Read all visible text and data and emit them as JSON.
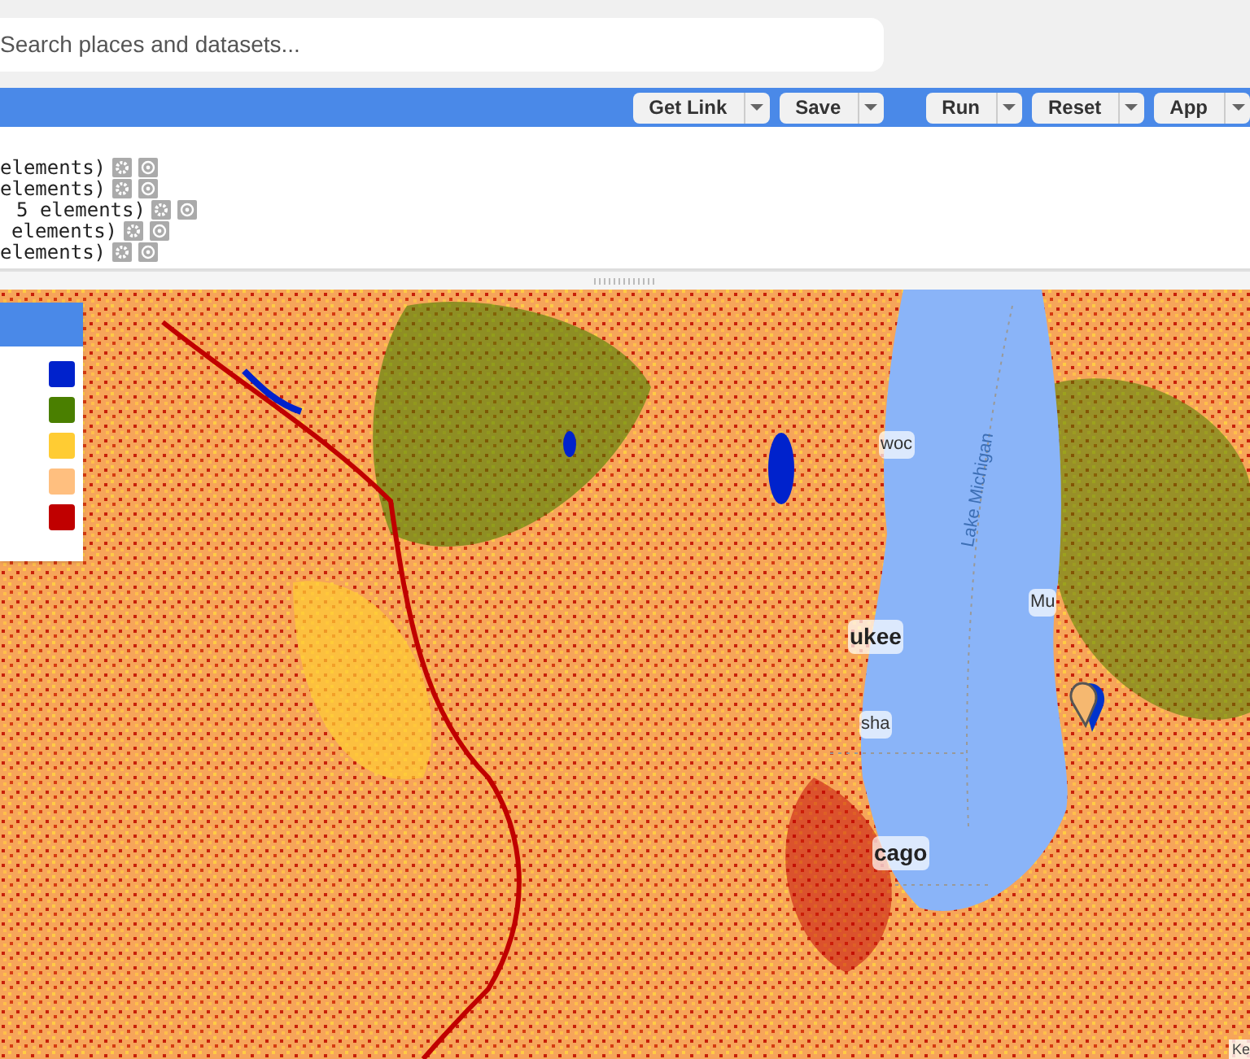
{
  "search": {
    "placeholder": "Search places and datasets..."
  },
  "toolbar": {
    "buttons": [
      {
        "label": "Get Link"
      },
      {
        "label": "Save"
      },
      {
        "label": "Run"
      },
      {
        "label": "Reset"
      },
      {
        "label": "App"
      }
    ]
  },
  "console": {
    "lines": [
      "elements)",
      "elements)",
      "5 elements)",
      "elements)",
      "elements)"
    ]
  },
  "legend": {
    "items": [
      {
        "color": "#0022cc"
      },
      {
        "color": "#4a7f00"
      },
      {
        "color": "#ffcc33"
      },
      {
        "color": "#ffbf7f"
      },
      {
        "color": "#c00000"
      }
    ]
  },
  "map": {
    "labels": [
      {
        "text": "woc",
        "kind": "city"
      },
      {
        "text": "Lake Michigan",
        "kind": "water"
      },
      {
        "text": "Mu",
        "kind": "city"
      },
      {
        "text": "ukee",
        "kind": "major"
      },
      {
        "text": "sha",
        "kind": "city"
      },
      {
        "text": "cago",
        "kind": "major"
      },
      {
        "text": "Ke",
        "kind": "attribution"
      }
    ]
  }
}
